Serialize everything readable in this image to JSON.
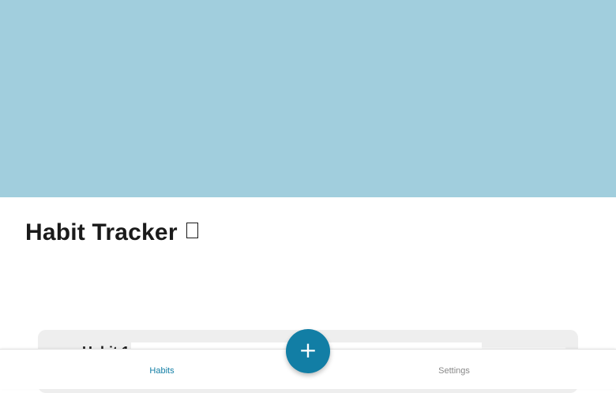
{
  "colors": {
    "banner": "#a1cedd",
    "accent": "#127ea5",
    "nav_inactive": "#888888"
  },
  "header": {
    "title": "Habit Tracker",
    "title_emoji_icon": "missing-glyph-icon"
  },
  "habits": [
    {
      "name": "Habit 1"
    }
  ],
  "fab": {
    "label": "+",
    "icon": "plus-icon"
  },
  "nav": {
    "items": [
      {
        "label": "Habits",
        "active": true
      },
      {
        "label": "Settings",
        "active": false
      }
    ]
  }
}
